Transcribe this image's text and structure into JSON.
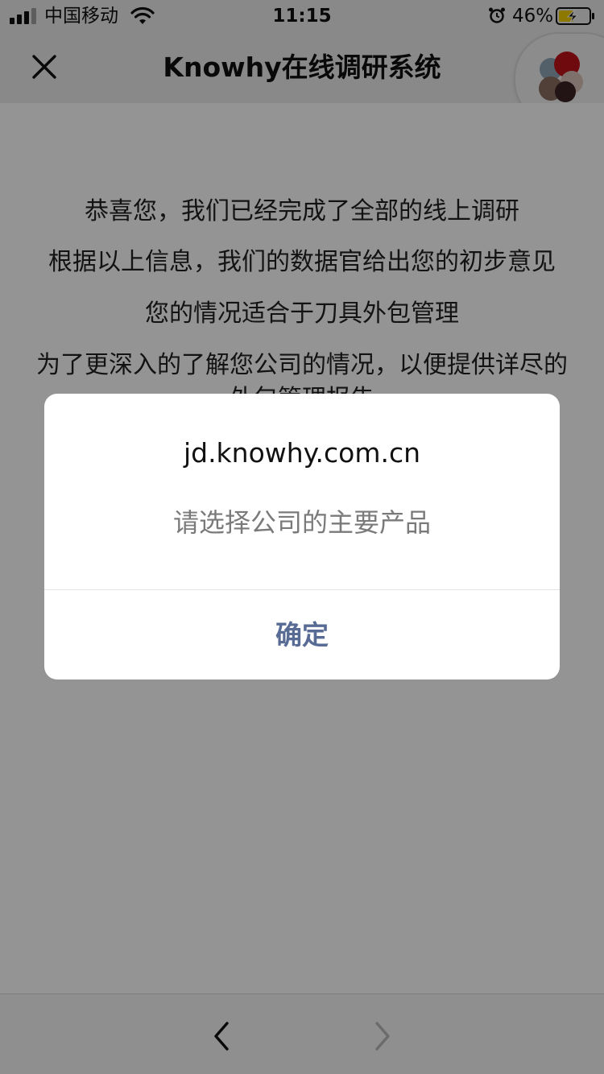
{
  "status_bar": {
    "carrier": "中国移动",
    "time": "11:15",
    "battery": "46%"
  },
  "nav": {
    "title": "Knowhy在线调研系统",
    "close_icon": "close-icon"
  },
  "content": {
    "lines": [
      "恭喜您，我们已经完成了全部的线上调研",
      "根据以上信息，我们的数据官给出您的初步意见",
      "您的情况适合于刀具外包管理",
      "为了更深入的了解您公司的情况，以便提供详尽的",
      "外包管理报告"
    ]
  },
  "dialog": {
    "title": "jd.knowhy.com.cn",
    "message": "请选择公司的主要产品",
    "confirm_label": "确定"
  },
  "colors": {
    "confirm": "#576b95",
    "overlay": "rgba(0,0,0,0.42)",
    "battery_charging": "#f5d000"
  }
}
